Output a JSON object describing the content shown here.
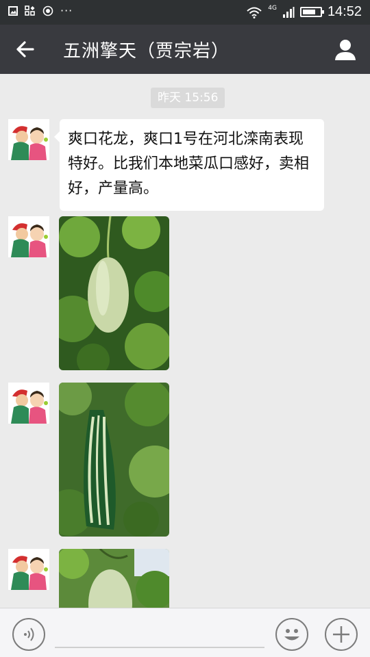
{
  "status_bar": {
    "time": "14:52",
    "network": "4G",
    "icons": [
      "image-icon",
      "grid-icon",
      "record-icon",
      "more-dots-icon",
      "wifi-icon",
      "signal-icon",
      "battery-icon"
    ],
    "battery_level": 0.75
  },
  "header": {
    "title": "五洲擎天（贾宗岩）",
    "back_icon": "arrow-left-icon",
    "profile_icon": "person-icon"
  },
  "chat": {
    "timestamp": "昨天 15:56",
    "messages": [
      {
        "type": "text",
        "text": "爽口花龙，爽口1号在河北滦南表现特好。比我们本地菜瓜口感好，卖相好，产量高。"
      },
      {
        "type": "image",
        "subject": "pale-green melon on vine"
      },
      {
        "type": "image",
        "subject": "striped green melon on vine"
      },
      {
        "type": "image",
        "subject": "pale melon partially visible"
      }
    ]
  },
  "input_bar": {
    "voice_icon": "voice-icon",
    "emoji_icon": "emoji-icon",
    "plus_icon": "plus-icon"
  },
  "colors": {
    "titlebar": "#393a3f",
    "statusbar": "#2e3133",
    "chat_bg": "#ebebeb",
    "bubble": "#ffffff"
  }
}
